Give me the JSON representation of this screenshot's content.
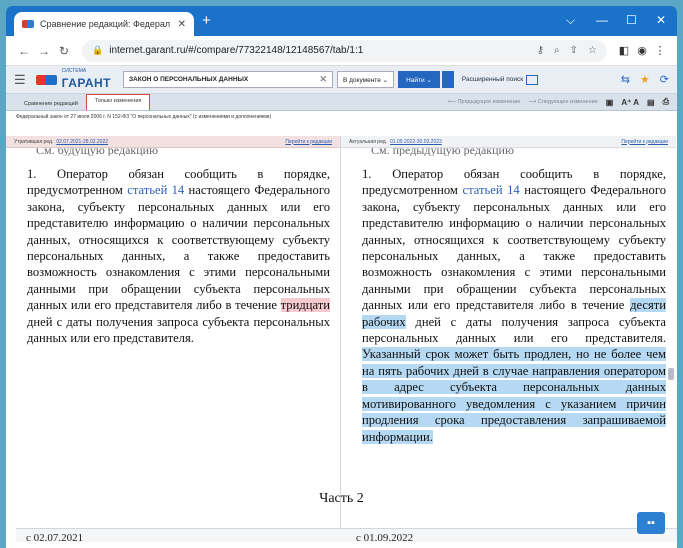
{
  "browser": {
    "tab_title": "Сравнение редакций: Федерал",
    "tab_close": "✕",
    "new_tab": "+",
    "win_min": "⌵",
    "win_min2": "—",
    "win_max": "☐",
    "win_close": "✕",
    "url": "internet.garant.ru/#/compare/77322148/12148567/tab/1:1"
  },
  "garant": {
    "logo_small": "СИСТЕМА",
    "logo_name": "ГАРАНТ",
    "search_value": "ЗАКОН О ПЕРСОНАЛЬНЫХ ДАННЫХ",
    "search_clear": "✕",
    "scope": "В документе ⌄",
    "find": "Найти ⌄",
    "advanced": "Расширенный поиск"
  },
  "compare_tabs": {
    "tab1": "Сравнение редакций",
    "tab2": "Только изменения",
    "prev": "⟵ Предыдущее изменение",
    "next": "⟶ Следующее изменение",
    "font_size": "A⁺ A"
  },
  "doc_line": "Федеральный закон от 27 июля 2006 г. N 152-ФЗ \"О персональных данных\" (с изменениями и дополнениями)",
  "left": {
    "status": "Утратившая ред.",
    "edition": "02.07.2021-28.02.2022",
    "link": "Перейти к редакции",
    "cut_text": "См. будущую редакцию",
    "p1_a": "1. Оператор обязан сообщить в порядке, предусмотренном ",
    "link_text": "статьей 14",
    "p1_b": " настоящего Федерального закона, субъекту персональных данных или его представителю информацию о наличии персональных данных, относящихся к соответствующему субъекту персональных данных, а также предоставить возможность ознакомления с этими персональными данными при обращении субъекта персональных данных или его представителя либо в течение ",
    "hl": "тридцати",
    "p1_c": " дней с даты получения запроса субъекта персональных данных или его представителя.",
    "bottom_date": "с 02.07.2021"
  },
  "right": {
    "status": "Актуальная ред.",
    "edition": "01.09.2022-30.03.2023",
    "link": "Перейти к редакции",
    "cut_text": "См. предыдущую редакцию",
    "p1_a": "1. Оператор обязан сообщить в порядке, предусмотренном ",
    "link_text": "статьей 14",
    "p1_b": " настоящего Федерального закона, субъекту персональных данных или его представителю информацию о наличии персональных данных, относящихся к соответствующему субъекту персональных данных, а также предоставить возможность ознакомления с этими персональными данными при обращении субъекта персональных данных или его представителя либо в течение ",
    "hl1": "десяти рабочих",
    "p1_c": " дней с даты получения запроса субъекта персональных данных или его представителя. ",
    "hl2": "Указанный срок может быть продлен, но не более чем на пять рабочих дней в случае направления оператором в адрес субъекта персональных данных мотивированного уведомления с указанием причин продления срока предоставления запрашиваемой информации.",
    "bottom_date": "с 01.09.2022"
  },
  "part_title": "Часть 2"
}
